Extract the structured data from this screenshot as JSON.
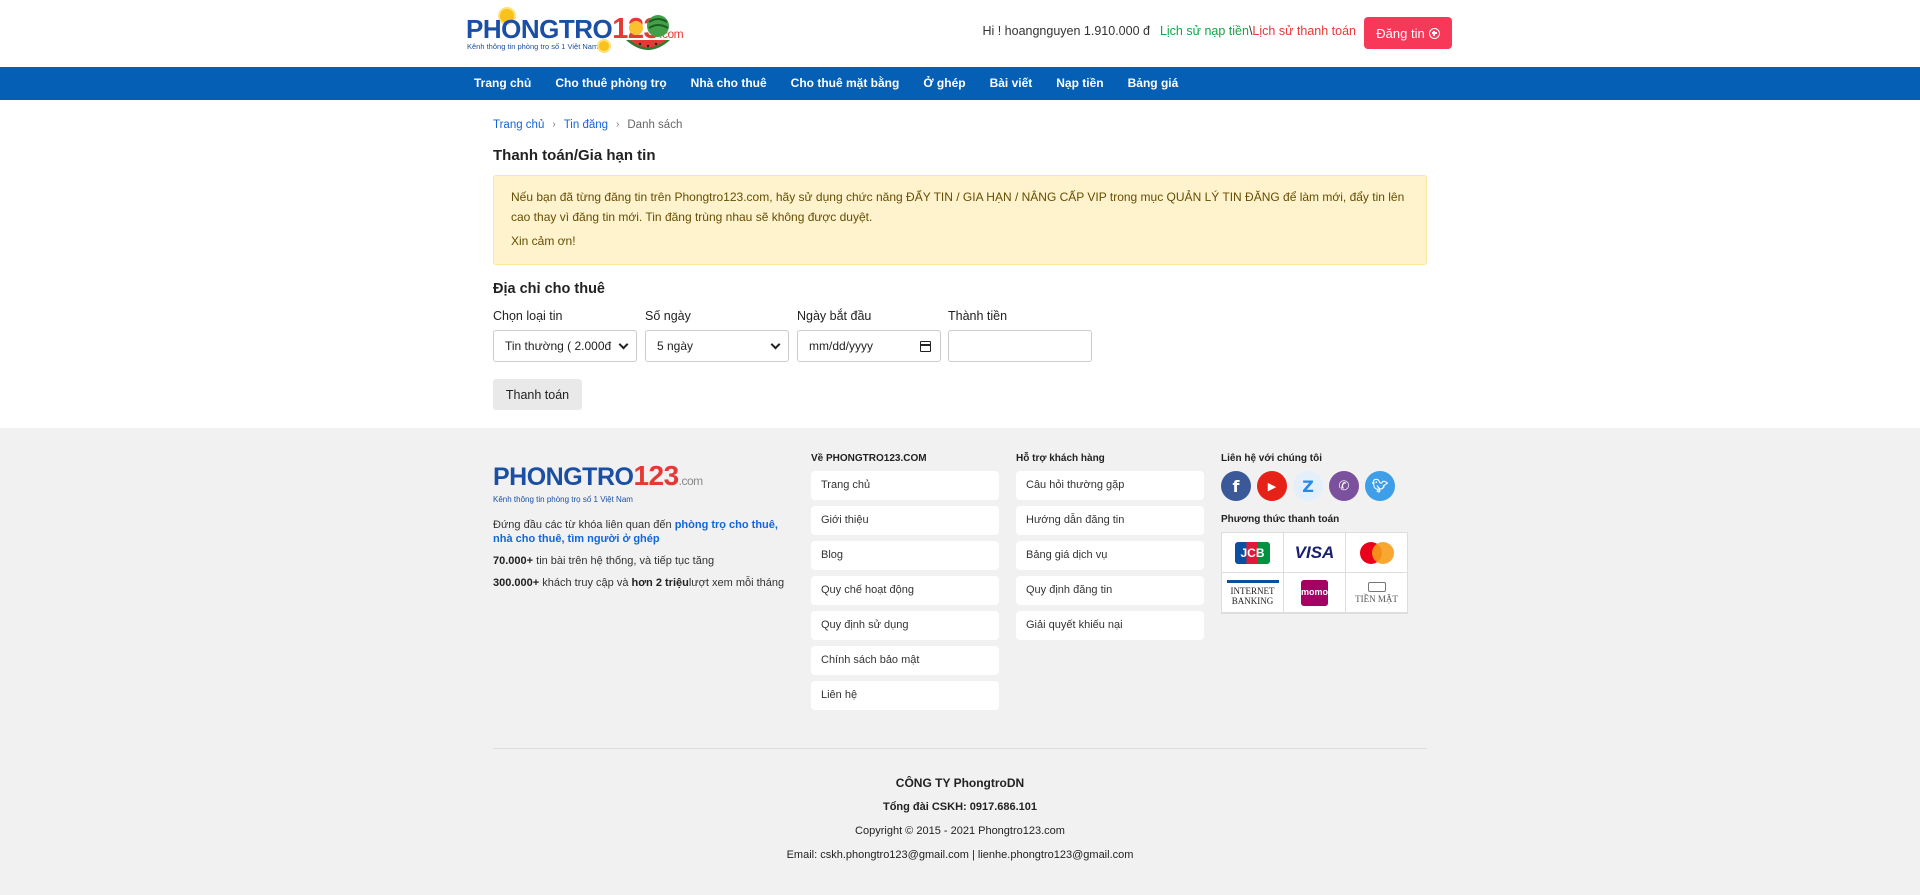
{
  "header": {
    "logo": {
      "brand_text": "PHONGTRO",
      "brand_num": "123",
      "brand_domain": ".com",
      "slogan": "Kênh thông tin phòng trọ số 1 Việt Nam"
    },
    "greeting": "Hi ! hoangnguyen 1.910.000 đ",
    "topup_history": "Lịch sử nạp tiền",
    "separator": "\\",
    "payment_history": "Lịch sử thanh toán",
    "post_button": "Đăng tin"
  },
  "nav": {
    "items": [
      {
        "label": "Trang chủ"
      },
      {
        "label": "Cho thuê phòng trọ"
      },
      {
        "label": "Nhà cho thuê"
      },
      {
        "label": "Cho thuê mặt bằng"
      },
      {
        "label": "Ở ghép"
      },
      {
        "label": "Bài viết"
      },
      {
        "label": "Nạp tiền"
      },
      {
        "label": "Bảng giá"
      }
    ]
  },
  "breadcrumb": {
    "home": "Trang chủ",
    "posts": "Tin đăng",
    "current": "Danh sách"
  },
  "page": {
    "title": "Thanh toán/Gia hạn tin",
    "notice_line1": "Nếu bạn đã từng đăng tin trên Phongtro123.com, hãy sử dụng chức năng ĐẨY TIN / GIA HẠN / NÂNG CẤP VIP trong mục QUẢN LÝ TIN ĐĂNG để làm mới, đẩy tin lên cao thay vì đăng tin mới. Tin đăng trùng nhau sẽ không được duyệt.",
    "notice_line2": "Xin cảm ơn!",
    "section_title": "Địa chỉ cho thuê"
  },
  "form": {
    "post_type_label": "Chọn loại tin",
    "post_type_value": "Tin thường ( 2.000đ",
    "days_label": "Số ngày",
    "days_value": "5 ngày",
    "start_date_label": "Ngày bắt đầu",
    "start_date_placeholder": "mm/dd/yyyy",
    "total_label": "Thành tiền",
    "total_value": "",
    "pay_button": "Thanh toán"
  },
  "footer": {
    "logo": {
      "brand_text": "PHONGTRO",
      "brand_num": "123",
      "brand_domain": ".com",
      "slogan": "Kênh thông tin phòng trọ số 1 Việt Nam"
    },
    "about_intro": "Đứng đầu các từ khóa liên quan đến ",
    "about_keywords": "phòng trọ cho thuê, nhà cho thuê, tìm người ở ghép",
    "stat1_num": "70.000+",
    "stat1_text": " tin bài trên hệ thống, và tiếp tục tăng",
    "stat2_num": "300.000+",
    "stat2_mid": " khách truy cập và ",
    "stat2_bold": "hơn 2 triệu",
    "stat2_text": "lượt xem mỗi tháng",
    "col_about_title": "Về PHONGTRO123.COM",
    "col_about_links": [
      "Trang chủ",
      "Giới thiệu",
      "Blog",
      "Quy chế hoạt động",
      "Quy định sử dụng",
      "Chính sách bảo mật",
      "Liên hệ"
    ],
    "col_support_title": "Hỗ trợ khách hàng",
    "col_support_links": [
      "Câu hỏi thường gặp",
      "Hướng dẫn đăng tin",
      "Bảng giá dịch vụ",
      "Quy định đăng tin",
      "Giải quyết khiếu nại"
    ],
    "contact_title": "Liên hệ với chúng tôi",
    "social_icons": [
      "facebook-icon",
      "youtube-icon",
      "zalo-icon",
      "viber-icon",
      "twitter-icon"
    ],
    "payment_title": "Phương thức thanh toán",
    "payment_jcb": "JCB",
    "payment_visa": "VISA",
    "payment_ib_1": "INTERNET",
    "payment_ib_2": "BANKING",
    "payment_momo_1": "mo",
    "payment_momo_2": "mo",
    "payment_cash": "TIỀN MẶT",
    "company": "CÔNG TY PhongtroDN",
    "hotline": "Tổng đài CSKH: 0917.686.101",
    "copyright": "Copyright © 2015 - 2021 Phongtro123.com",
    "email": "Email: cskh.phongtro123@gmail.com | lienhe.phongtro123@gmail.com"
  },
  "colors": {
    "nav_bg": "#055fb5",
    "post_button_bg": "#f73859",
    "notice_bg": "#fff3cd",
    "footer_bg": "#f1f1f1",
    "link_blue": "#1266dd"
  }
}
